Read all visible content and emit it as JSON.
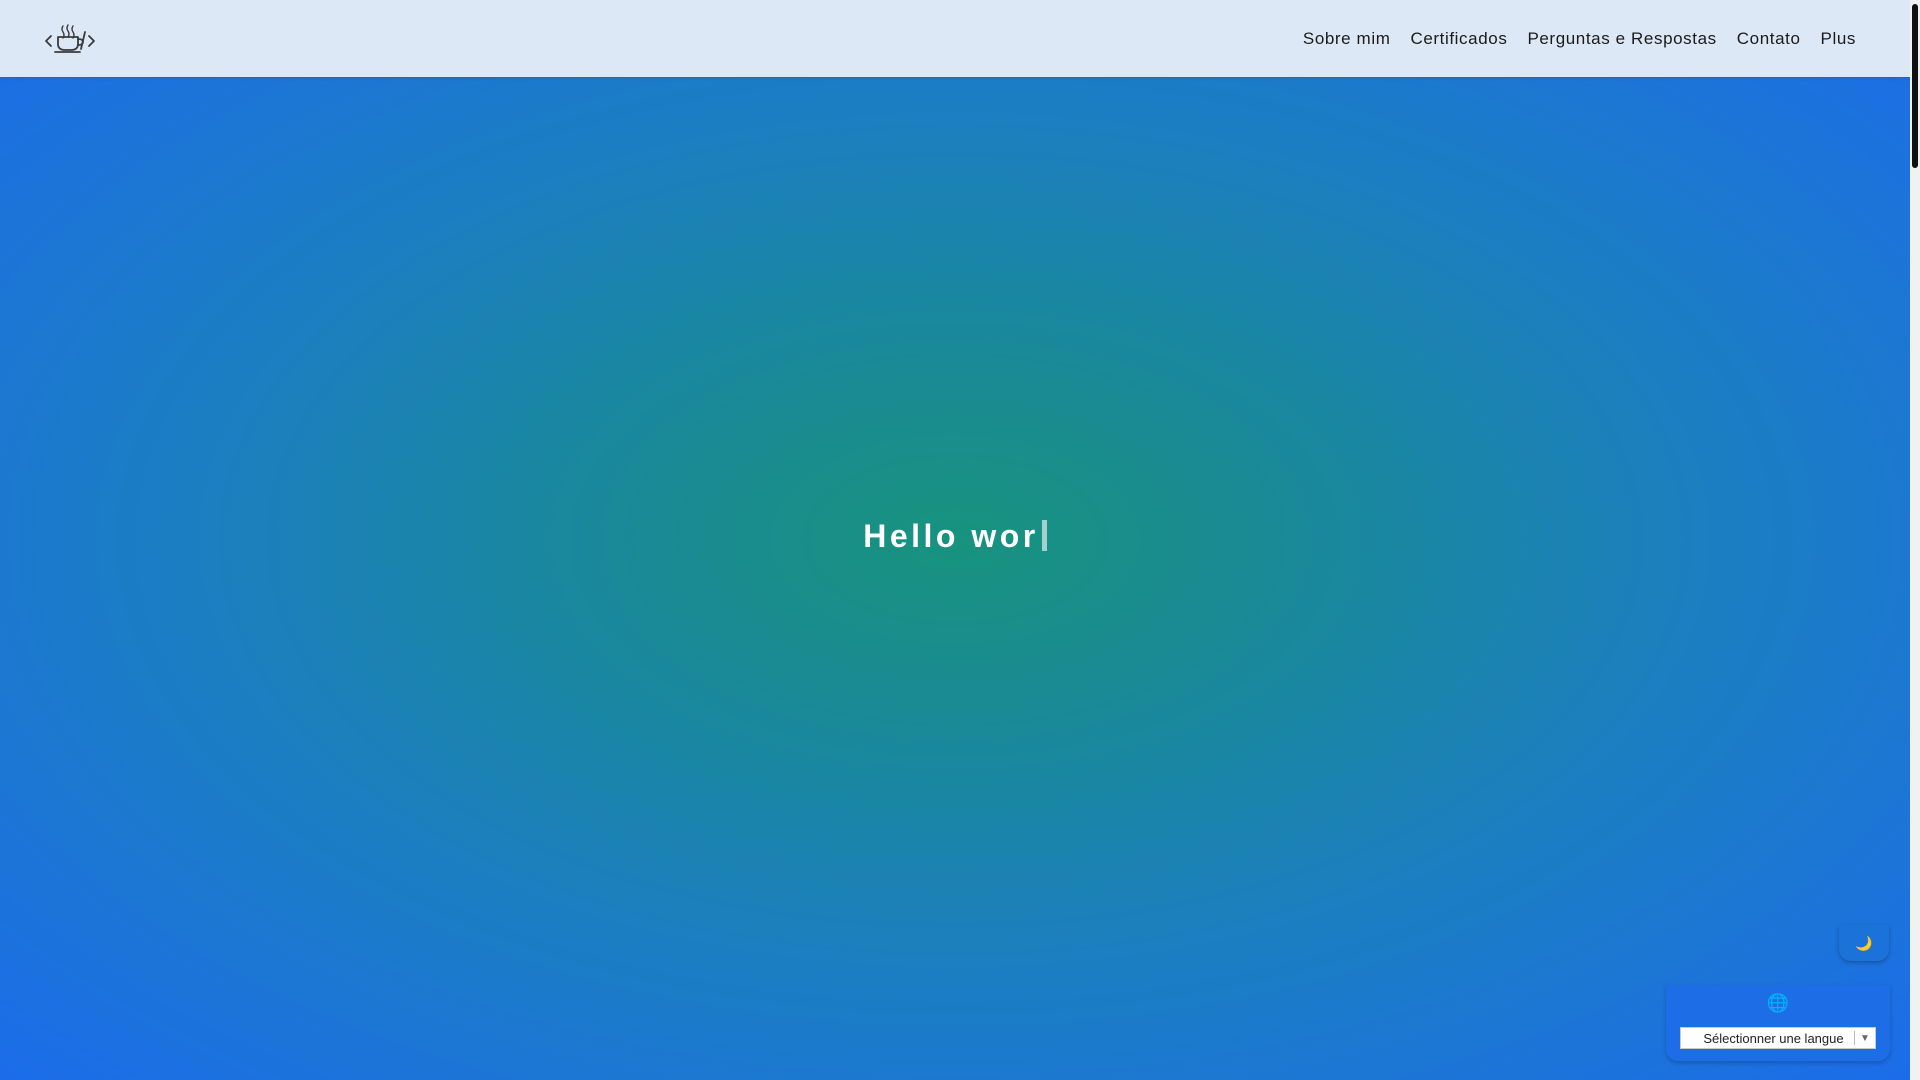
{
  "navbar": {
    "logo_icon": "coffee-code-icon",
    "links": [
      {
        "label": "Sobre mim"
      },
      {
        "label": "Certificados"
      },
      {
        "label": "Perguntas e Respostas"
      },
      {
        "label": "Contato"
      },
      {
        "label": "Plus"
      }
    ]
  },
  "hero": {
    "typed_text": "Hello wor"
  },
  "theme_toggle": {
    "icon": "moon-icon"
  },
  "language": {
    "icon": "globe-icon",
    "select_label": "Sélectionner une langue",
    "arrow": "▼"
  },
  "colors": {
    "navbar_bg": "#dde8f7",
    "hero_center": "#18937e",
    "hero_edge": "#1c6cea",
    "text_light": "#ffffff"
  }
}
